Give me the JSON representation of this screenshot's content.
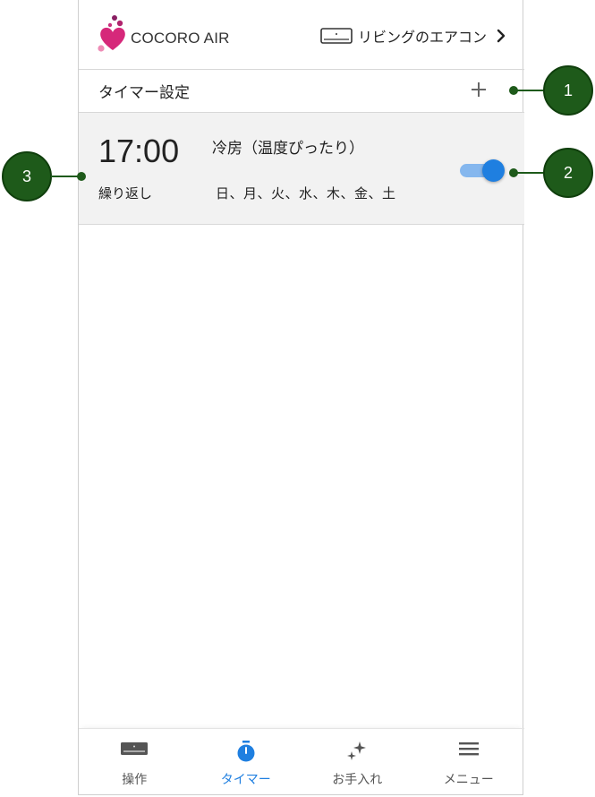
{
  "header": {
    "brand": "COCORO AIR",
    "device_name": "リビングのエアコン"
  },
  "timer_settings": {
    "title": "タイマー設定"
  },
  "timers": [
    {
      "time": "17:00",
      "mode": "冷房（温度ぴったり）",
      "repeat_label": "繰り返し",
      "repeat_days": "日、月、火、水、木、金、土",
      "enabled": true
    }
  ],
  "bottom_nav": {
    "items": [
      {
        "label": "操作",
        "icon": "aircon-icon"
      },
      {
        "label": "タイマー",
        "icon": "stopwatch-icon",
        "active": true
      },
      {
        "label": "お手入れ",
        "icon": "sparkle-icon"
      },
      {
        "label": "メニュー",
        "icon": "hamburger-menu-icon"
      }
    ]
  },
  "callouts": [
    "1",
    "2",
    "3"
  ],
  "colors": {
    "accent": "#1f7fe0",
    "toggle_track": "#85b7ee",
    "brand_pink": "#d6287a",
    "callout": "#1e5a1a",
    "card_bg": "#f2f2f2"
  }
}
